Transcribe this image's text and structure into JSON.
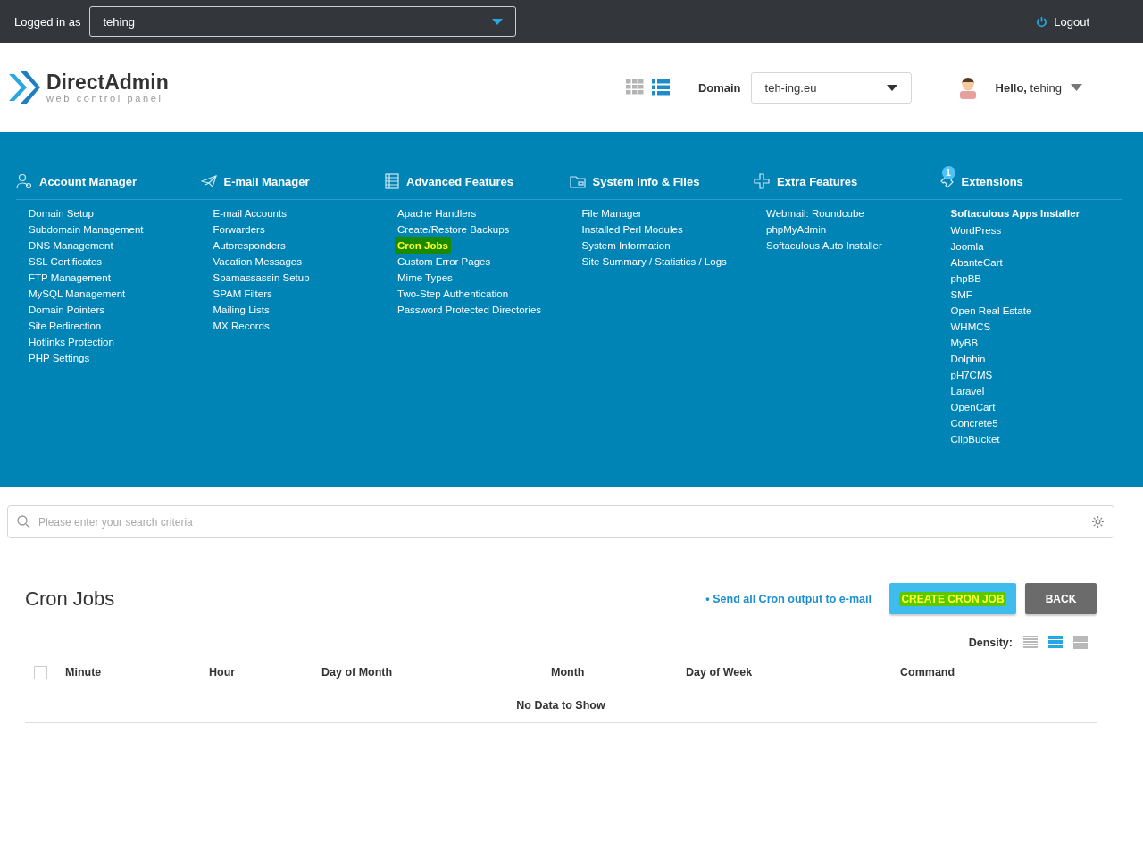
{
  "top_bar": {
    "logged_in_label": "Logged in as",
    "user_select": "tehing",
    "logout": "Logout"
  },
  "header": {
    "logo_name": "DirectAdmin",
    "logo_tagline": "web control panel",
    "view_modes": [
      {
        "kind": "grid",
        "selected": false
      },
      {
        "kind": "list",
        "selected": true
      }
    ],
    "domain_label": "Domain",
    "domain_select": "teh-ing.eu",
    "greeting": "**Hello,** tehing"
  },
  "menu": [
    {
      "title": "Account Manager",
      "kind": "account",
      "items": [
        {
          "label": "Domain Setup",
          "selected": false
        },
        {
          "label": "Subdomain Management",
          "selected": false
        },
        {
          "label": "DNS Management",
          "selected": false
        },
        {
          "label": "SSL Certificates",
          "selected": false
        },
        {
          "label": "FTP Management",
          "selected": false
        },
        {
          "label": "MySQL Management",
          "selected": false
        },
        {
          "label": "Domain Pointers",
          "selected": false
        },
        {
          "label": "Site Redirection",
          "selected": false
        },
        {
          "label": "Hotlinks Protection",
          "selected": false
        },
        {
          "label": "PHP Settings",
          "selected": false
        }
      ]
    },
    {
      "title": "E-mail Manager",
      "kind": "email",
      "items": [
        {
          "label": "E-mail Accounts",
          "selected": false
        },
        {
          "label": "Forwarders",
          "selected": false
        },
        {
          "label": "Autoresponders",
          "selected": false
        },
        {
          "label": "Vacation Messages",
          "selected": false
        },
        {
          "label": "Spamassassin Setup",
          "selected": false
        },
        {
          "label": "SPAM Filters",
          "selected": false
        },
        {
          "label": "Mailing Lists",
          "selected": false
        },
        {
          "label": "MX Records",
          "selected": false
        }
      ]
    },
    {
      "title": "Advanced Features",
      "kind": "advanced",
      "items": [
        {
          "label": "Apache Handlers",
          "selected": false
        },
        {
          "label": "Create/Restore Backups",
          "selected": false
        },
        {
          "label": "Cron Jobs",
          "selected": true
        },
        {
          "label": "Custom Error Pages",
          "selected": false
        },
        {
          "label": "Mime Types",
          "selected": false
        },
        {
          "label": "Two-Step Authentication",
          "selected": false
        },
        {
          "label": "Password Protected Directories",
          "selected": false
        }
      ]
    },
    {
      "title": "System Info & Files",
      "kind": "system",
      "items": [
        {
          "label": "File Manager",
          "selected": false
        },
        {
          "label": "Installed Perl Modules",
          "selected": false
        },
        {
          "label": "System Information",
          "selected": false
        },
        {
          "label": "Site Summary / Statistics / Logs",
          "selected": false
        }
      ]
    },
    {
      "title": "Extra Features",
      "kind": "extra",
      "items": [
        {
          "label": "Webmail: Roundcube",
          "selected": false
        },
        {
          "label": "phpMyAdmin",
          "selected": false
        },
        {
          "label": "Softaculous Auto Installer",
          "selected": false
        }
      ]
    },
    {
      "title": "Extensions",
      "kind": "extensions",
      "badge": "1",
      "subheading": "Softaculous Apps Installer",
      "items": [
        {
          "label": "WordPress",
          "selected": false
        },
        {
          "label": "Joomla",
          "selected": false
        },
        {
          "label": "AbanteCart",
          "selected": false
        },
        {
          "label": "phpBB",
          "selected": false
        },
        {
          "label": "SMF",
          "selected": false
        },
        {
          "label": "Open Real Estate",
          "selected": false
        },
        {
          "label": "WHMCS",
          "selected": false
        },
        {
          "label": "MyBB",
          "selected": false
        },
        {
          "label": "Dolphin",
          "selected": false
        },
        {
          "label": "pH7CMS",
          "selected": false
        },
        {
          "label": "Laravel",
          "selected": false
        },
        {
          "label": "OpenCart",
          "selected": false
        },
        {
          "label": "Concrete5",
          "selected": false
        },
        {
          "label": "ClipBucket",
          "selected": false
        }
      ]
    }
  ],
  "search": {
    "placeholder": "Please enter your search criteria"
  },
  "page": {
    "title": "Cron Jobs",
    "link": "• Send all Cron output to e-mail",
    "buttons": [
      {
        "label": "CREATE CRON JOB",
        "kind": "primary",
        "highlighted": true
      },
      {
        "label": "BACK",
        "kind": "secondary",
        "highlighted": false
      }
    ],
    "density": {
      "label": "Density:",
      "options": [
        {
          "kind": "compact",
          "selected": false
        },
        {
          "kind": "normal",
          "selected": true
        },
        {
          "kind": "wide",
          "selected": false
        }
      ]
    },
    "table": {
      "select_all_checked": false,
      "columns": [
        "Minute",
        "Hour",
        "Day of Month",
        "Month",
        "Day of Week",
        "Command"
      ],
      "empty_message": "No Data to Show"
    }
  }
}
